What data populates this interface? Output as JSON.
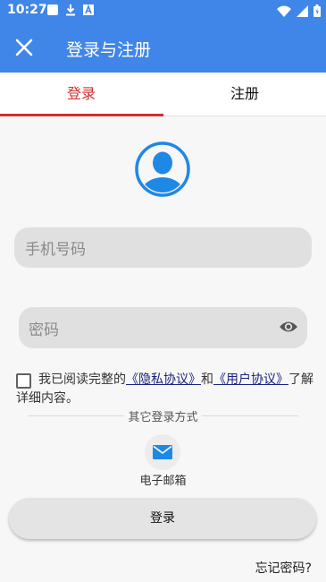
{
  "status_bar": {
    "time": "10:27",
    "icons": [
      "square-icon",
      "download-icon",
      "font-icon",
      "wifi-icon",
      "signal-icon",
      "battery-icon"
    ]
  },
  "app_bar": {
    "title": "登录与注册",
    "close_icon": "close-icon",
    "background": "#3f86e8"
  },
  "tabs": [
    {
      "label": "登录",
      "selected": true
    },
    {
      "label": "注册",
      "selected": false
    }
  ],
  "accent_color": "#d32f2f",
  "avatar_color": "#1e88e5",
  "form": {
    "phone_placeholder": "手机号码",
    "password_placeholder": "密码"
  },
  "agreement": {
    "prefix": "我已阅读完整的",
    "privacy_link": "《隐私协议》",
    "and": "和",
    "user_link": "《用户协议》",
    "suffix": "了解",
    "line2": "详细内容。"
  },
  "other_login": {
    "title": "其它登录方式",
    "email_label": "电子邮箱"
  },
  "login_button": "登录",
  "forgot_password": "忘记密码?"
}
